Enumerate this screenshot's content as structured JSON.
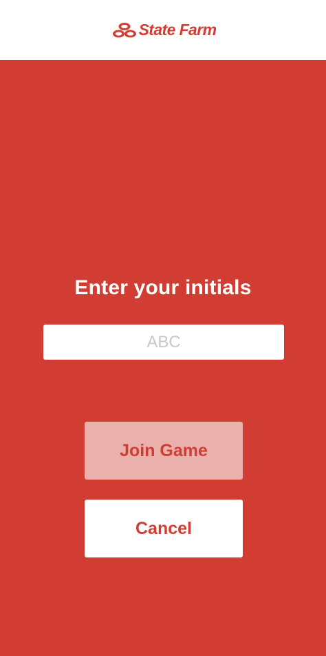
{
  "header": {
    "brand_name": "State Farm",
    "logo_icon": "state-farm-three-ovals-icon",
    "brand_color": "#d13d33"
  },
  "main": {
    "background_color": "#d13d33",
    "prompt": "Enter your initials",
    "initials_input": {
      "placeholder": "ABC",
      "value": ""
    },
    "join_button": {
      "label": "Join Game",
      "state": "disabled",
      "background_color": "#eab0ac"
    },
    "cancel_button": {
      "label": "Cancel",
      "background_color": "#ffffff"
    }
  }
}
